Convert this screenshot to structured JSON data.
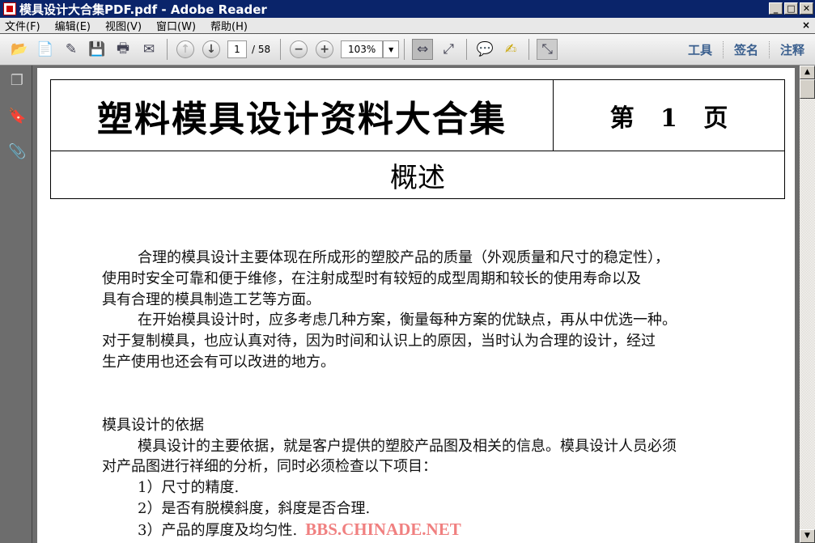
{
  "window": {
    "title": "模具设计大合集PDF.pdf - Adobe Reader",
    "min": "_",
    "max": "□",
    "close": "✕"
  },
  "menu": [
    "文件(F)",
    "编辑(E)",
    "视图(V)",
    "窗口(W)",
    "帮助(H)"
  ],
  "menu_close": "×",
  "toolbar": {
    "page_current": "1",
    "page_total": "/ 58",
    "zoom": "103%",
    "tools": "工具",
    "sign": "签名",
    "comment": "注释"
  },
  "document": {
    "header_title": "塑料模具设计资料大合集",
    "header_page": "第 1 页",
    "section_title": "概述",
    "paragraphs": [
      "合理的模具设计主要体现在所成形的塑胶产品的质量（外观质量和尺寸的稳定性），",
      "使用时安全可靠和便于维修，在注射成型时有较短的成型周期和较长的使用寿命以及",
      "具有合理的模具制造工艺等方面。",
      "在开始模具设计时，应多考虑几种方案，衡量每种方案的优缺点，再从中优选一种。",
      "对于复制模具，也应认真对待，因为时间和认识上的原因，当时认为合理的设计，经过",
      "生产使用也还会有可以改进的地方。"
    ],
    "basis_heading": "模具设计的依据",
    "basis": [
      "模具设计的主要依据，就是客户提供的塑胶产品图及相关的信息。模具设计人员必须",
      "对产品图进行祥细的分析，同时必须检查以下项目：",
      "1）尺寸的精度.",
      "2）是否有脱模斜度，斜度是否合理.",
      "3）产品的厚度及均匀性."
    ],
    "watermark": "BBS.CHINADE.NET"
  }
}
